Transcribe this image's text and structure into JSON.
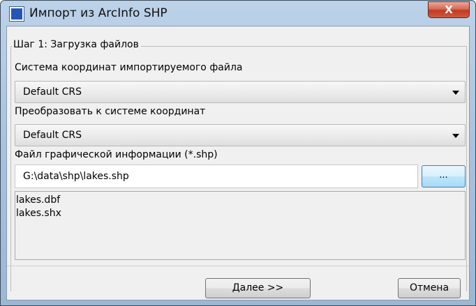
{
  "window": {
    "title": "Импорт из ArcInfo SHP",
    "close_glyph": "X",
    "accent_color": "#2456b8"
  },
  "step": {
    "legend": "Шаг 1: Загрузка файлов"
  },
  "source_crs": {
    "label": "Система координат импортируемого файла",
    "value": "Default CRS"
  },
  "target_crs": {
    "label": "Преобразовать к системе координат",
    "value": "Default CRS"
  },
  "shp_file": {
    "label": "Файл графической информации (*.shp)",
    "value": "G:\\data\\shp\\lakes.shp",
    "browse_label": "..."
  },
  "related_files": [
    "lakes.dbf",
    "lakes.shx"
  ],
  "buttons": {
    "next": "Далее >>",
    "cancel": "Отмена"
  }
}
